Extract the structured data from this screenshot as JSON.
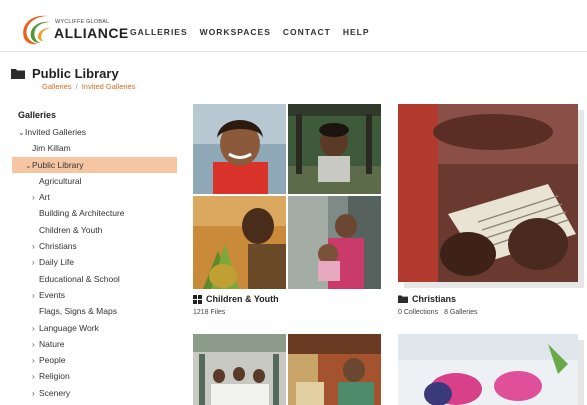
{
  "brand": {
    "small": "WYCLIFFE GLOBAL",
    "big": "ALLIANCE",
    "colors": {
      "orange": "#e8641e",
      "green": "#4a9a3a",
      "dark": "#222222"
    }
  },
  "nav": [
    "GALLERIES",
    "WORKSPACES",
    "CONTACT",
    "HELP"
  ],
  "page": {
    "title": "Public Library",
    "breadcrumb": [
      "Galleries",
      "Invited Galleries"
    ]
  },
  "sidebar": {
    "heading": "Galleries",
    "items": [
      {
        "label": "Invited Galleries",
        "chevron": "down"
      },
      {
        "label": "Jim Killam",
        "chevron": ""
      },
      {
        "label": "Public Library",
        "chevron": "down",
        "active": true
      },
      {
        "label": "Agricultural",
        "chevron": ""
      },
      {
        "label": "Art",
        "chevron": "right"
      },
      {
        "label": "Building & Architecture",
        "chevron": ""
      },
      {
        "label": "Children & Youth",
        "chevron": ""
      },
      {
        "label": "Christians",
        "chevron": "right"
      },
      {
        "label": "Daily Life",
        "chevron": "right"
      },
      {
        "label": "Educational & School",
        "chevron": ""
      },
      {
        "label": "Events",
        "chevron": "right"
      },
      {
        "label": "Flags, Signs & Maps",
        "chevron": ""
      },
      {
        "label": "Language Work",
        "chevron": "right"
      },
      {
        "label": "Nature",
        "chevron": "right"
      },
      {
        "label": "People",
        "chevron": "right"
      },
      {
        "label": "Religion",
        "chevron": "right"
      },
      {
        "label": "Scenery",
        "chevron": "right"
      }
    ]
  },
  "cards": [
    {
      "title": "Children & Youth",
      "icon": "grid-icon",
      "meta": [
        "1218 Files"
      ]
    },
    {
      "title": "Christians",
      "icon": "folder-icon",
      "meta": [
        "0 Collections",
        "8 Galleries"
      ]
    }
  ]
}
